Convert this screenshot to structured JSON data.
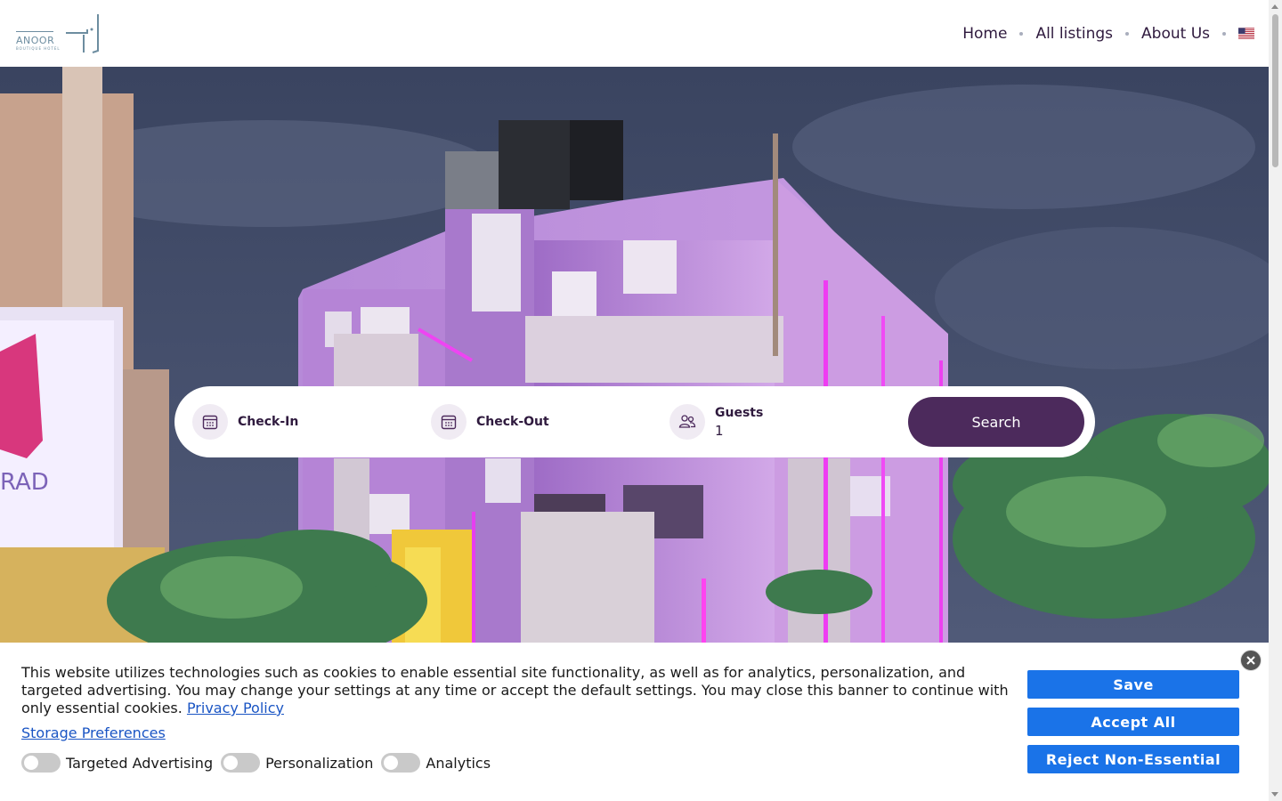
{
  "brand": {
    "logo_name": "ANOOR",
    "logo_sub": "BOUTIQUE HOTEL"
  },
  "nav": {
    "items": [
      {
        "label": "Home"
      },
      {
        "label": "All listings"
      },
      {
        "label": "About Us"
      }
    ],
    "language_flag": "us-flag-icon"
  },
  "search": {
    "checkin_label": "Check-In",
    "checkout_label": "Check-Out",
    "guests_label": "Guests",
    "guests_value": "1",
    "search_button": "Search"
  },
  "cookie_banner": {
    "text": "This website utilizes technologies such as cookies to enable essential site functionality, as well as for analytics, personalization, and targeted advertising. You may change your settings at any time or accept the default settings. You may close this banner to continue with only essential cookies.",
    "privacy_link": "Privacy Policy",
    "storage_link": "Storage Preferences",
    "toggles": [
      {
        "label": "Targeted Advertising"
      },
      {
        "label": "Personalization"
      },
      {
        "label": "Analytics"
      }
    ],
    "save_button": "Save",
    "accept_button": "Accept All",
    "reject_button": "Reject Non-Essential",
    "close_icon": "close-icon"
  },
  "colors": {
    "brand_purple": "#4c2a5c",
    "cookie_button_blue": "#1a73e8",
    "link_blue": "#1a55c4"
  }
}
